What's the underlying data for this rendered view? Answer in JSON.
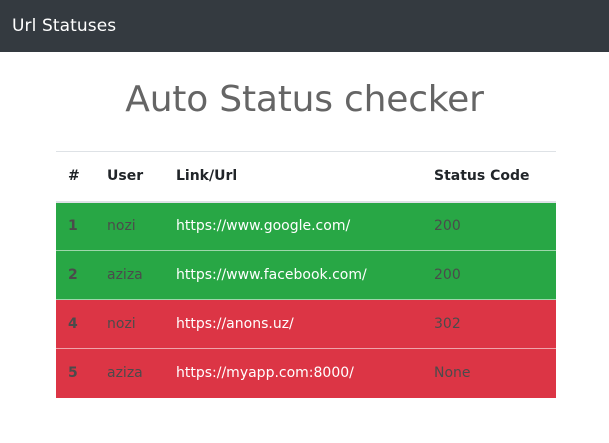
{
  "navbar": {
    "brand": "Url Statuses"
  },
  "page": {
    "title": "Auto Status checker"
  },
  "table": {
    "headers": [
      "#",
      "User",
      "Link/Url",
      "Status Code"
    ],
    "rows": [
      {
        "num": "1",
        "user": "nozi",
        "link": "https://www.google.com/",
        "status": "200",
        "state": "ok",
        "color": "#28a745"
      },
      {
        "num": "2",
        "user": "aziza",
        "link": "https://www.facebook.com/",
        "status": "200",
        "state": "ok",
        "color": "#28a745"
      },
      {
        "num": "4",
        "user": "nozi",
        "link": "https://anons.uz/",
        "status": "302",
        "state": "bad",
        "color": "#dc3545"
      },
      {
        "num": "5",
        "user": "aziza",
        "link": "https://myapp.com:8000/",
        "status": "None",
        "state": "bad",
        "color": "#dc3545"
      }
    ]
  },
  "colors": {
    "navbar": "#343a40",
    "success": "#28a745",
    "danger": "#dc3545"
  }
}
